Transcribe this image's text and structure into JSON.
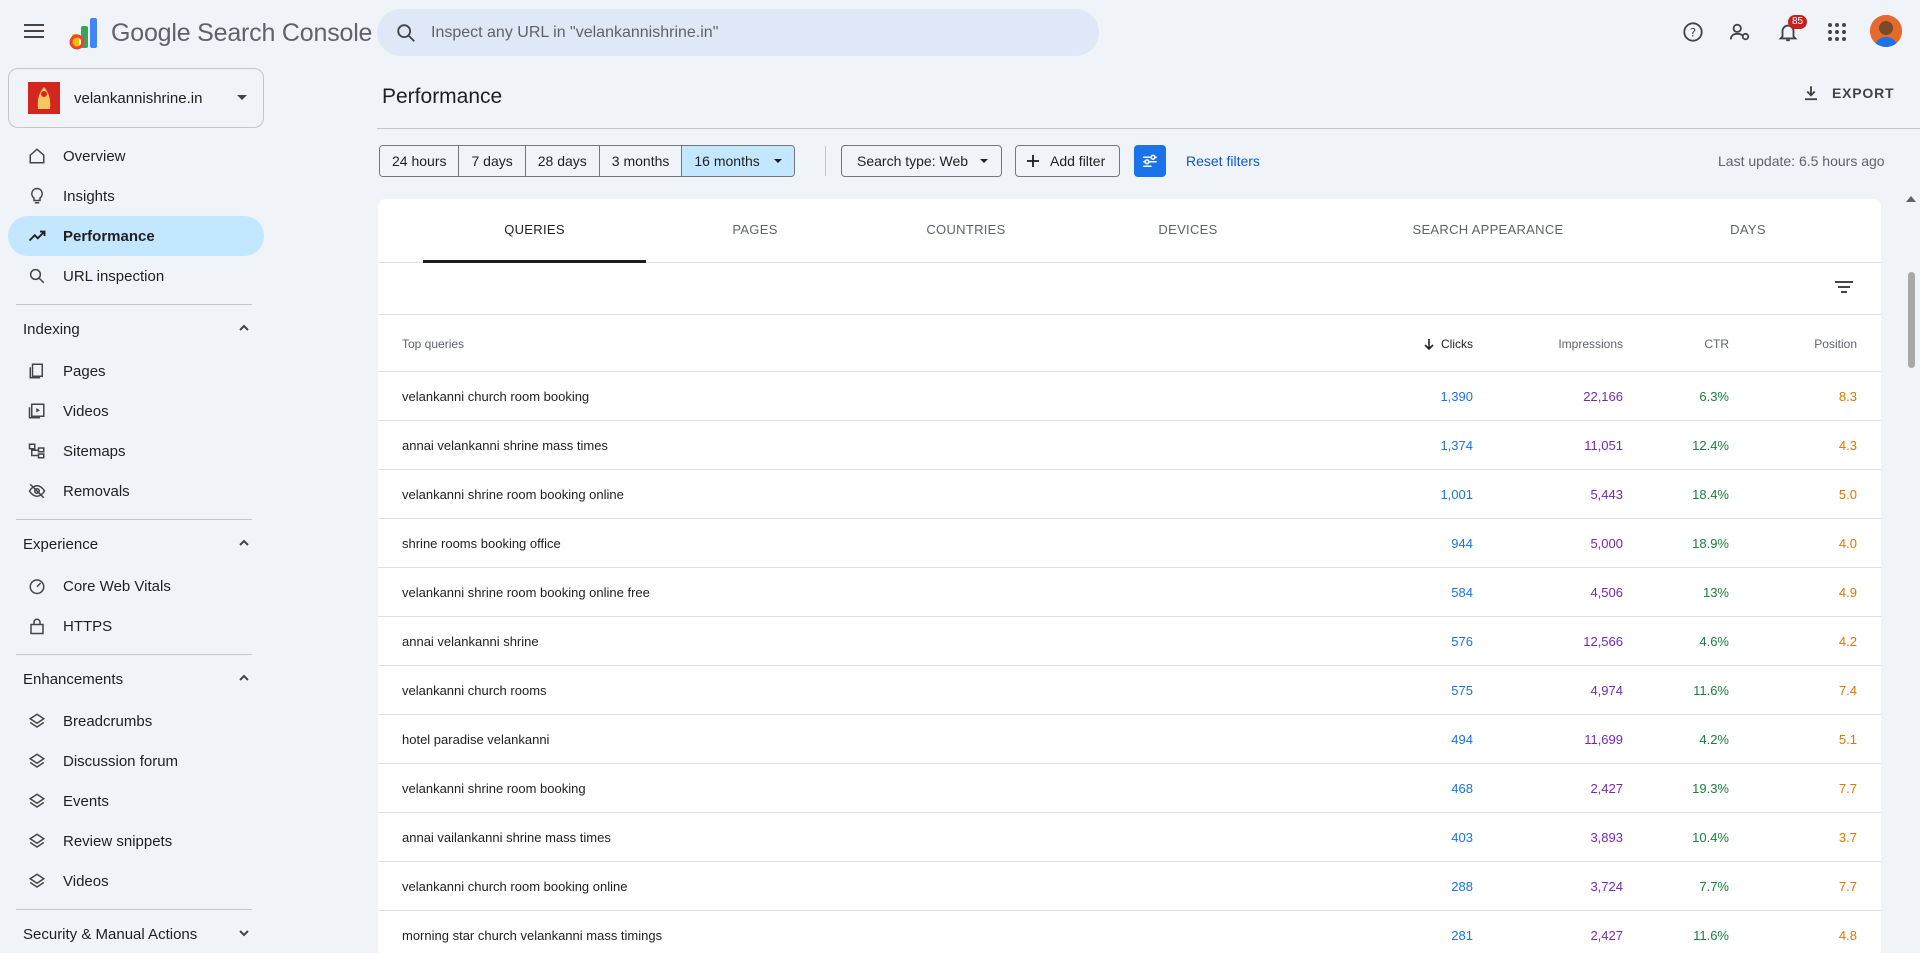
{
  "app": {
    "title_google": "Google",
    "title_rest": "Search Console",
    "search_placeholder": "Inspect any URL in \"velankannishrine.in\"",
    "notifications_count": "85"
  },
  "property": {
    "name": "velankannishrine.in"
  },
  "sidebar": {
    "top_items": [
      {
        "label": "Overview",
        "icon": "home-icon"
      },
      {
        "label": "Insights",
        "icon": "lightbulb-icon"
      },
      {
        "label": "Performance",
        "icon": "trending-up-icon",
        "active": true
      },
      {
        "label": "URL inspection",
        "icon": "search-icon"
      }
    ],
    "sections": [
      {
        "label": "Indexing",
        "items": [
          "Pages",
          "Videos",
          "Sitemaps",
          "Removals"
        ]
      },
      {
        "label": "Experience",
        "items": [
          "Core Web Vitals",
          "HTTPS"
        ]
      },
      {
        "label": "Enhancements",
        "items": [
          "Breadcrumbs",
          "Discussion forum",
          "Events",
          "Review snippets",
          "Videos"
        ]
      },
      {
        "label": "Security & Manual Actions",
        "items": []
      }
    ]
  },
  "header": {
    "title": "Performance",
    "export_label": "EXPORT"
  },
  "filters": {
    "date_ranges": [
      "24 hours",
      "7 days",
      "28 days",
      "3 months",
      "16 months"
    ],
    "selected_range": "16 months",
    "search_type": "Search type: Web",
    "add_filter": "Add filter",
    "reset": "Reset filters",
    "last_update": "Last update: 6.5 hours ago"
  },
  "tabs": [
    "QUERIES",
    "PAGES",
    "COUNTRIES",
    "DEVICES",
    "SEARCH APPEARANCE",
    "DAYS"
  ],
  "active_tab": "QUERIES",
  "table": {
    "headers": {
      "query": "Top queries",
      "clicks": "Clicks",
      "impressions": "Impressions",
      "ctr": "CTR",
      "position": "Position"
    },
    "rows": [
      {
        "query": "velankanni church room booking",
        "clicks": "1,390",
        "impressions": "22,166",
        "ctr": "6.3%",
        "position": "8.3"
      },
      {
        "query": "annai velankanni shrine mass times",
        "clicks": "1,374",
        "impressions": "11,051",
        "ctr": "12.4%",
        "position": "4.3"
      },
      {
        "query": "velankanni shrine room booking online",
        "clicks": "1,001",
        "impressions": "5,443",
        "ctr": "18.4%",
        "position": "5.0"
      },
      {
        "query": "shrine rooms booking office",
        "clicks": "944",
        "impressions": "5,000",
        "ctr": "18.9%",
        "position": "4.0"
      },
      {
        "query": "velankanni shrine room booking online free",
        "clicks": "584",
        "impressions": "4,506",
        "ctr": "13%",
        "position": "4.9"
      },
      {
        "query": "annai velankanni shrine",
        "clicks": "576",
        "impressions": "12,566",
        "ctr": "4.6%",
        "position": "4.2"
      },
      {
        "query": "velankanni church rooms",
        "clicks": "575",
        "impressions": "4,974",
        "ctr": "11.6%",
        "position": "7.4"
      },
      {
        "query": "hotel paradise velankanni",
        "clicks": "494",
        "impressions": "11,699",
        "ctr": "4.2%",
        "position": "5.1"
      },
      {
        "query": "velankanni shrine room booking",
        "clicks": "468",
        "impressions": "2,427",
        "ctr": "19.3%",
        "position": "7.7"
      },
      {
        "query": "annai vailankanni shrine mass times",
        "clicks": "403",
        "impressions": "3,893",
        "ctr": "10.4%",
        "position": "3.7"
      },
      {
        "query": "velankanni church room booking online",
        "clicks": "288",
        "impressions": "3,724",
        "ctr": "7.7%",
        "position": "7.7"
      },
      {
        "query": "morning star church velankanni mass timings",
        "clicks": "281",
        "impressions": "2,427",
        "ctr": "11.6%",
        "position": "4.8"
      }
    ]
  },
  "colors": {
    "clicks": "#1a73e8",
    "impressions": "#7627bb",
    "ctr": "#188038",
    "position": "#e37400",
    "active_nav": "#c2e7ff",
    "accent": "#1a73e8"
  }
}
